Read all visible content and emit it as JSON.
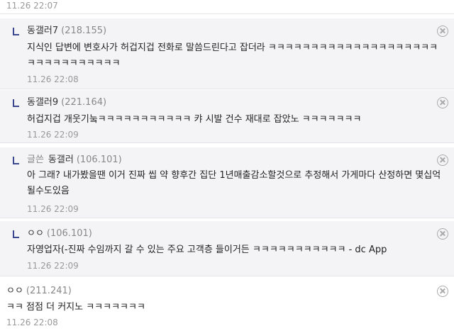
{
  "top_timestamp": "11.26 22:07",
  "comments": [
    {
      "nick": "동갤러7",
      "ip": "(218.155)",
      "text": "지식인 답변에 변호사가 허겁지겁 전화로 말씀드린다고 잡더라 ㅋㅋㅋㅋㅋㅋㅋㅋㅋㅋㅋㅋㅋㅋㅋㅋㅋㅋㅋㅋㅋㅋㅋㅋㅋㅋㅋㅋㅋㅋㅋ",
      "time": "11.26 22:08"
    },
    {
      "nick": "동갤러9",
      "ip": "(221.164)",
      "text": "허겁지겁 개웃기눜ㅋㅋㅋㅋㅋㅋㅋㅋㅋㅋㅋ 캬 시발 건수 재대로 잡았노 ㅋㅋㅋㅋㅋㅋㅋ",
      "time": "11.26 22:09"
    },
    {
      "badge": "글쓴",
      "nick": "동갤러",
      "ip": "(106.101)",
      "text": "아 그래? 내가봤을땐 이거 진짜 씹 약 향후간 집단 1년매출감소할것으로 추정해서 가게마다 산정하면 몇십억 될수도있음",
      "time": "11.26 22:09"
    },
    {
      "nick": "ㅇㅇ",
      "ip": "(106.101)",
      "text": "자영업자(-진짜 수임까지 갈 수 있는 주요 고객층 들이거든 ㅋㅋㅋㅋㅋㅋㅋㅋㅋㅋㅋ - dc App",
      "time": "11.26 22:09"
    },
    {
      "nick": "ㅇㅇ",
      "ip": "(211.241)",
      "text": "ㅋㅋ 점점 더 커지노 ㅋㅋㅋㅋㅋㅋㅋ",
      "time": "11.26 22:08"
    }
  ]
}
